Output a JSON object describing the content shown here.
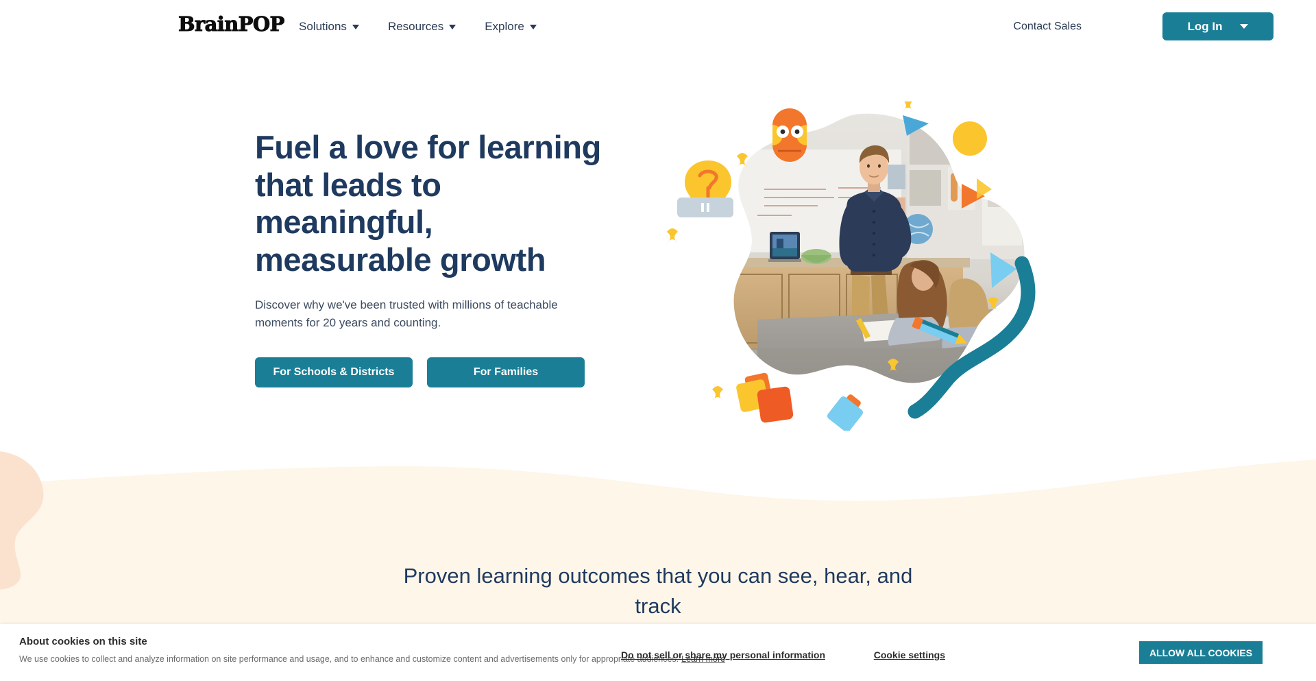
{
  "header": {
    "logo_text": "BrainPOP",
    "nav_items": [
      {
        "label": "Solutions",
        "icon": "chevron-down-icon"
      },
      {
        "label": "Resources",
        "icon": "chevron-down-icon"
      },
      {
        "label": "Explore",
        "icon": "chevron-down-icon"
      }
    ],
    "contact_sales_label": "Contact Sales",
    "login_label": "Log In",
    "login_caret_icon": "chevron-down-icon"
  },
  "hero": {
    "title": "Fuel a love for learning that leads to meaningful, measurable growth",
    "subtitle": "Discover why we've been trusted with millions of teachable moments for 20 years and counting.",
    "cta_schools": "For Schools & Districts",
    "cta_families": "For Families",
    "pause_button_icon": "pause-icon"
  },
  "proven": {
    "title": "Proven learning outcomes that you can see, hear, and track"
  },
  "cookies": {
    "title": "About cookies on this site",
    "body": "We use cookies to collect and analyze information on site performance and usage, and to enhance and customize content and advertisements only for appropriate audiences.",
    "learn_more": "Learn more",
    "do_not_sell": "Do not sell or share my personal information",
    "settings": "Cookie settings",
    "allow_all": "ALLOW ALL COOKIES"
  },
  "colors": {
    "teal": "#1a7e96",
    "navy": "#1f3a5f",
    "cream": "#fdf6e9",
    "peach": "#fbe2ce",
    "orange": "#f2762b",
    "yellow": "#fbc52e",
    "sky": "#79cdf0"
  }
}
